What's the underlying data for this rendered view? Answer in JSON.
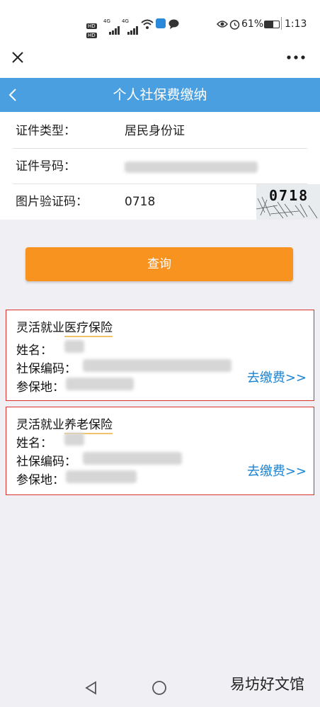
{
  "status_bar": {
    "battery": "61%",
    "time": "1:13",
    "net1": "4G",
    "net2": "4G"
  },
  "top_bar": {
    "close_icon": "close-icon",
    "more_icon": "more-icon"
  },
  "header": {
    "back_icon": "chevron-left-icon",
    "title": "个人社保费缴纳"
  },
  "form": {
    "id_type_label": "证件类型：",
    "id_type_value": "居民身份证",
    "id_number_label": "证件号码：",
    "captcha_label": "图片验证码：",
    "captcha_input": "0718",
    "captcha_image_text": "0718"
  },
  "query_button": "查询",
  "cards": [
    {
      "title_prefix": "灵活就业",
      "title_highlight": "医疗保险",
      "name_label": "姓名：",
      "code_label": "社保编码：",
      "place_label": "参保地：",
      "pay_link": "去缴费>>"
    },
    {
      "title_prefix": "灵活就业",
      "title_highlight": "养老保险",
      "name_label": "姓名：",
      "code_label": "社保编码：",
      "place_label": "参保地：",
      "pay_link": "去缴费>>"
    }
  ],
  "nav_bar": {
    "back": "back-triangle-icon",
    "home": "home-circle-icon"
  },
  "watermark": "易坊好文馆",
  "colors": {
    "header": "#4a9fe0",
    "button": "#f7931e",
    "card_border": "#d9322c",
    "link": "#1a84d4"
  }
}
